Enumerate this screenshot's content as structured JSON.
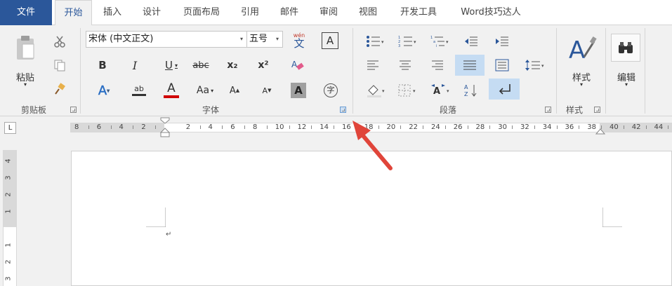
{
  "tabs": {
    "file": "文件",
    "home": "开始",
    "insert": "插入",
    "design": "设计",
    "layout": "页面布局",
    "references": "引用",
    "mailings": "邮件",
    "review": "审阅",
    "view": "视图",
    "developer": "开发工具",
    "word_master": "Word技巧达人"
  },
  "clipboard": {
    "paste_label": "粘贴",
    "group_label": "剪贴板"
  },
  "font": {
    "font_name": "宋体 (中文正文)",
    "font_size": "五号",
    "phonetic_glyph": "wén",
    "phonetic_char": "文",
    "group_label": "字体",
    "bold": "B",
    "italic": "I",
    "underline": "U",
    "strike": "abc",
    "subscript": "x₂",
    "superscript": "x²",
    "change_case": "Aa",
    "grow": "A",
    "shrink": "A",
    "char_shading": "A",
    "enclose": "字",
    "highlight": "ab",
    "font_color": "A",
    "border": "A",
    "effects": "A"
  },
  "paragraph": {
    "group_label": "段落"
  },
  "styles": {
    "label": "样式",
    "group_label": "样式"
  },
  "editing": {
    "label": "编辑"
  },
  "ruler": {
    "tab_selector": "L",
    "numbers": [
      "8",
      "6",
      "4",
      "2",
      "2",
      "4",
      "6",
      "8",
      "10",
      "12",
      "14",
      "16",
      "18",
      "20",
      "22",
      "24",
      "26",
      "28",
      "30",
      "32",
      "34",
      "36",
      "38",
      "40",
      "42",
      "44"
    ]
  },
  "vertical_ruler": {
    "numbers": [
      "4",
      "3",
      "2",
      "1",
      "1",
      "2",
      "3"
    ]
  },
  "document": {
    "paragraph_mark": "↵"
  },
  "colors": {
    "file_tab": "#2b579a",
    "selected_button": "#c5dcf3",
    "font_color_bar": "#d00000",
    "arrow": "#e0453a"
  },
  "icons": [
    "scissors-icon",
    "copy-icon",
    "format-painter-icon",
    "clipboard-icon",
    "bullets-icon",
    "numbering-icon",
    "multilevel-icon",
    "decrease-indent-icon",
    "increase-indent-icon",
    "align-left-icon",
    "center-icon",
    "align-right-icon",
    "justify-icon",
    "distributed-icon",
    "line-spacing-icon",
    "shading-icon",
    "borders-icon",
    "chinese-layout-icon",
    "sort-icon",
    "show-marks-icon",
    "styles-icon",
    "find-icon"
  ]
}
